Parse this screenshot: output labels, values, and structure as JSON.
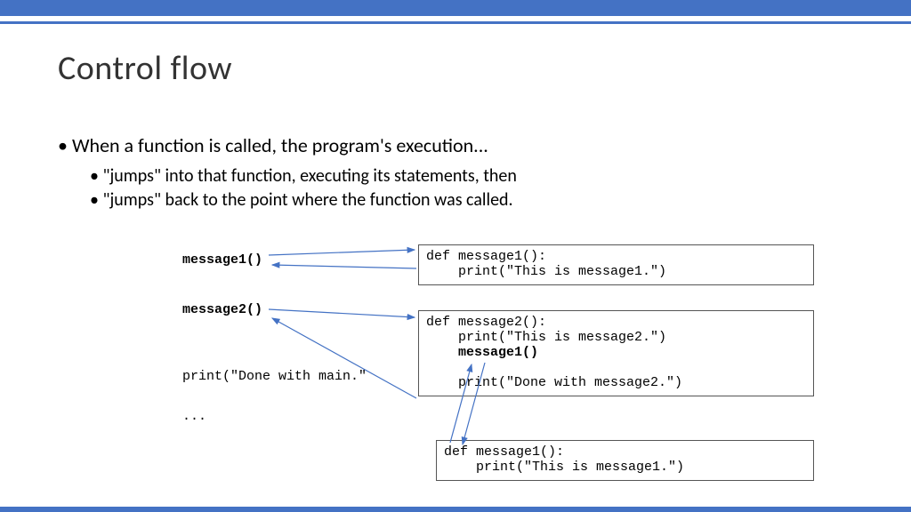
{
  "title": "Control flow",
  "bullets": {
    "main": "When a function is called, the program's execution...",
    "sub1": "\"jumps\" into that function, executing its statements, then",
    "sub2": "\"jumps\" back to the point where the function was called."
  },
  "left_code": {
    "l1": "message1()",
    "l2": "message2()",
    "l3": "print(\"Done with main.\"",
    "l4": "..."
  },
  "box1": {
    "line1": "def message1():",
    "line2": "    print(\"This is message1.\")"
  },
  "box2": {
    "line1": "def message2():",
    "line2": "    print(\"This is message2.\")",
    "line3_indent": "    ",
    "line3_call": "message1()",
    "blank": " ",
    "line4": "    print(\"Done with message2.\")"
  },
  "box3": {
    "line1": "def message1():",
    "line2": "    print(\"This is message1.\")"
  },
  "colors": {
    "accent": "#4472c4",
    "arrow": "#4472c4"
  }
}
